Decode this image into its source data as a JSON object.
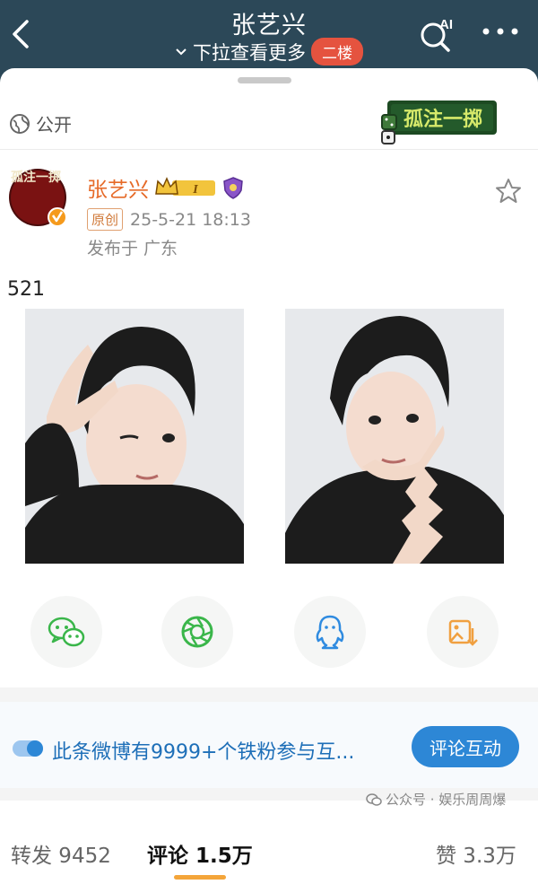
{
  "header": {
    "title": "张艺兴",
    "pull_hint": "下拉查看更多",
    "floor_badge": "二楼",
    "ai_label": "AI"
  },
  "post": {
    "visibility": "公开",
    "promo_logo_text": "孤注一掷",
    "author": "张艺兴",
    "badge_level": "I",
    "original_tag": "原创",
    "timestamp": "25-5-21 18:13",
    "location": "发布于 广东",
    "text": "521",
    "avatar_text": "孤注一掷"
  },
  "share": {
    "items": [
      "wechat-icon",
      "moments-icon",
      "qq-icon",
      "save-image-icon"
    ]
  },
  "fan_bar": {
    "text": "此条微博有9999+个铁粉参与互...",
    "button": "评论互动"
  },
  "tabs": {
    "repost": "转发 9452",
    "comment": "评论 1.5万",
    "like": "赞 3.3万"
  },
  "watermark": "公众号 · 娱乐周周爆",
  "colors": {
    "nav_bg": "#2c4858",
    "author": "#e66a28",
    "link_blue": "#1e6fb8",
    "button_blue": "#2d87d6",
    "badge_red": "#e5533f",
    "tab_underline": "#f4a53a"
  }
}
